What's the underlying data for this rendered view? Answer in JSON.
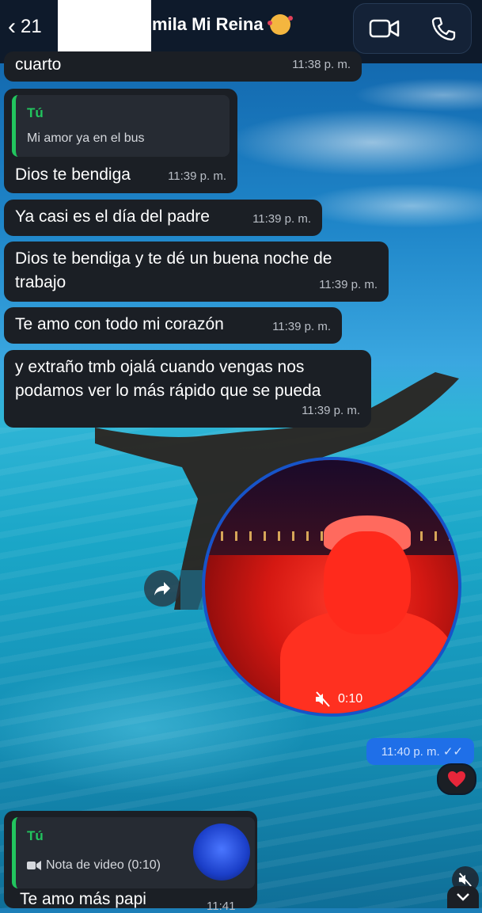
{
  "header": {
    "back_count": "21",
    "contact_name": "mila Mi Reina",
    "video_icon": "video-call-icon",
    "call_icon": "phone-call-icon"
  },
  "messages": [
    {
      "text": "cuarto",
      "time": "11:38 p. m."
    },
    {
      "reply_author": "Tú",
      "reply_text": "Mi amor ya en el bus",
      "text": "Dios te bendiga",
      "time": "11:39 p. m."
    },
    {
      "text": "Ya casi es el día del padre",
      "time": "11:39 p. m."
    },
    {
      "line1": "Dios te bendiga y te dé un buena noche de",
      "line2": "trabajo",
      "time": "11:39 p. m."
    },
    {
      "text": "Te amo con todo mi corazón",
      "time": "11:39 p. m."
    },
    {
      "line1": "y extraño tmb ojalá cuando vengas nos",
      "line2": "podamos ver lo más rápido que se pueda",
      "time": "11:39 p. m."
    }
  ],
  "video_note": {
    "duration": "0:10",
    "sent_time": "11:40 p. m.",
    "reaction": "heart"
  },
  "last_message": {
    "reply_author": "Tú",
    "reply_note": "Nota de video (0:10)",
    "text": "Te amo más papi",
    "time": "11:41"
  },
  "colors": {
    "header_bg": "#0e1a2b",
    "bubble_bg": "#1b1f25",
    "reply_accent": "#22c55e",
    "sent_bubble": "#1f6fe8",
    "video_ring": "#1654c9"
  }
}
